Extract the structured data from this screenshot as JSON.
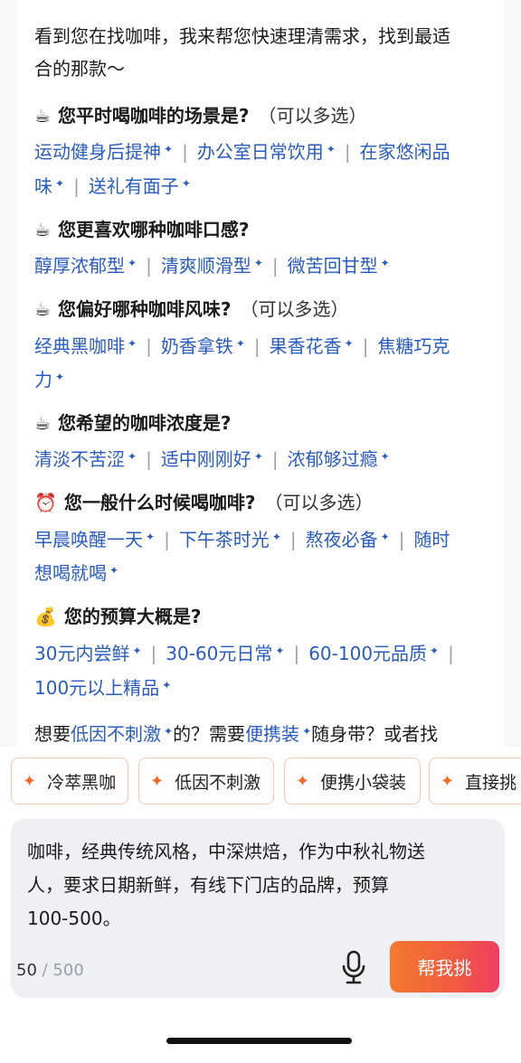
{
  "intro_line1": "看到您在找咖啡，我来帮您快速理清需求，找到最适",
  "intro_line2": "合的那款～",
  "questions": [
    {
      "emoji": "☕",
      "title": "您平时喝咖啡的场景是?",
      "note": "（可以多选）",
      "options": [
        "运动健身后提神",
        "办公室日常饮用",
        "在家悠闲品",
        "味",
        "送礼有面子"
      ]
    },
    {
      "emoji": "☕",
      "title": "您更喜欢哪种咖啡口感?",
      "note": "",
      "options": [
        "醇厚浓郁型",
        "清爽顺滑型",
        "微苦回甘型"
      ]
    },
    {
      "emoji": "☕",
      "title": "您偏好哪种咖啡风味?",
      "note": "（可以多选）",
      "options": [
        "经典黑咖啡",
        "奶香拿铁",
        "果香花香",
        "焦糖巧克",
        "力"
      ]
    },
    {
      "emoji": "☕",
      "title": "您希望的咖啡浓度是?",
      "note": "",
      "options": [
        "清淡不苦涩",
        "适中刚刚好",
        "浓郁够过瘾"
      ]
    },
    {
      "emoji": "⏰",
      "title": "您一般什么时候喝咖啡?",
      "note": "（可以多选）",
      "options": [
        "早晨唤醒一天",
        "下午茶时光",
        "熬夜必备",
        "随时",
        "想喝就喝"
      ]
    },
    {
      "emoji": "💰",
      "title": "您的预算大概是?",
      "note": "",
      "options": [
        "30元内尝鲜",
        "30-60元日常",
        "60-100元品质",
        "100元以上精品"
      ]
    }
  ],
  "closing": {
    "part1": "想要",
    "link1": "低因不刺激",
    "part2": "的？需要",
    "link2": "便携装",
    "part3": "随身带？或者找"
  },
  "quick_replies": [
    "冷萃黑咖",
    "低因不刺激",
    "便携小袋装",
    "直接挑"
  ],
  "input": {
    "line1": "咖啡，经典传统风格，中深烘焙，作为中秋礼物送",
    "line2": "人，要求日期新鲜，有线下门店的品牌，预算",
    "line3": "100-500。",
    "count": "50",
    "max": "500"
  },
  "send_label": "帮我挑",
  "icons": {
    "sparkle": "sparkle-icon",
    "mic": "microphone-icon"
  },
  "colors": {
    "link": "#2a5bbf",
    "accent": "#f06a2c"
  }
}
